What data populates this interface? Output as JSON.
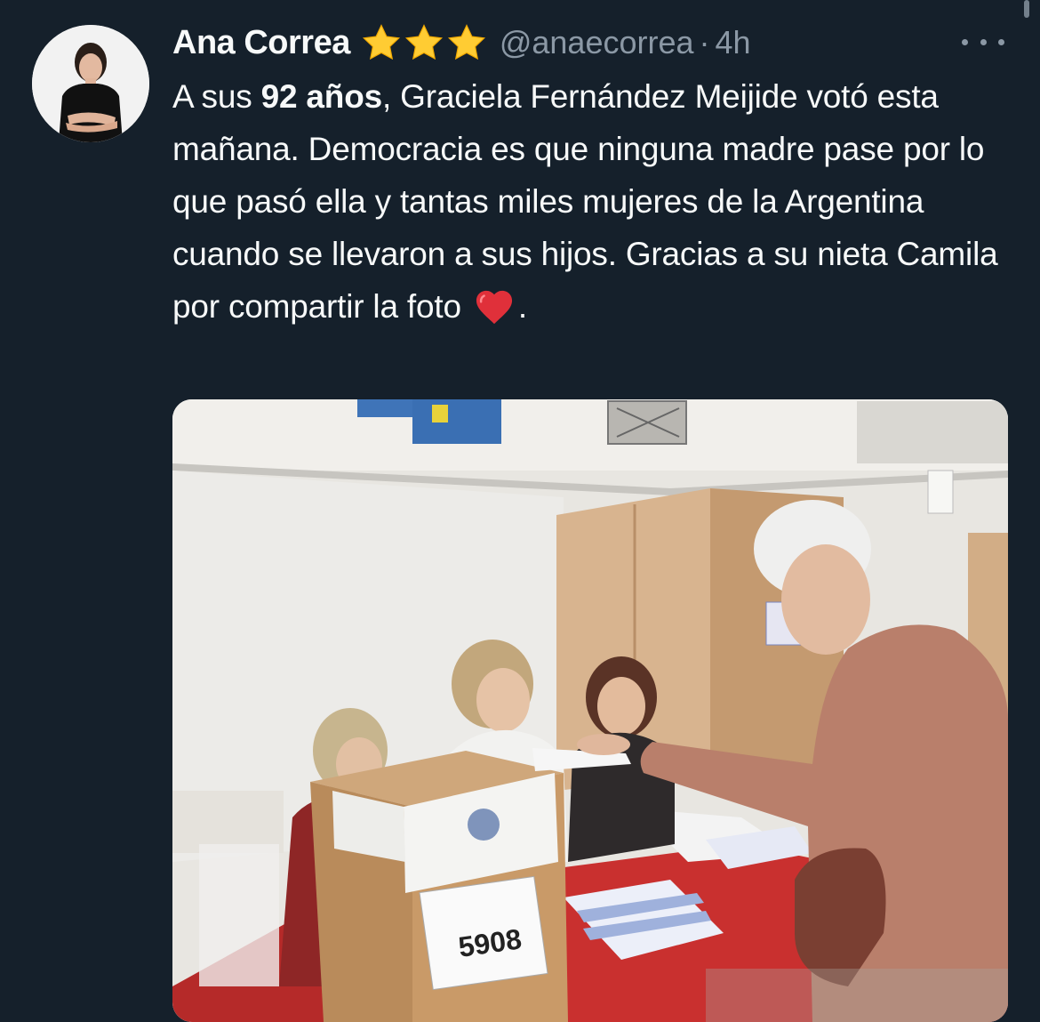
{
  "tweet": {
    "author_name": "Ana Correa",
    "handle": "@anaecorrea",
    "separator": "·",
    "time": "4h",
    "badge_icons": [
      "star-icon",
      "star-icon",
      "star-icon"
    ],
    "text_prefix": "A sus ",
    "text_bold": "92 años",
    "text_main": ", Graciela Fernández Meijide votó esta mañana. Democracia es que ninguna madre pase por lo que pasó ella y tantas miles mujeres de la Argentina cuando se llevaron a sus hijos. Gracias a su nieta Camila por compartir la foto",
    "text_emoji": "red-heart-icon",
    "text_suffix": ".",
    "more_icon": "more-options-icon"
  },
  "media": {
    "ballot_box_number": "5908"
  },
  "colors": {
    "background": "#15202b",
    "text_primary": "#f7f9f9",
    "text_secondary": "#8b98a5",
    "star": "#ffcc33",
    "heart": "#e0303a"
  }
}
